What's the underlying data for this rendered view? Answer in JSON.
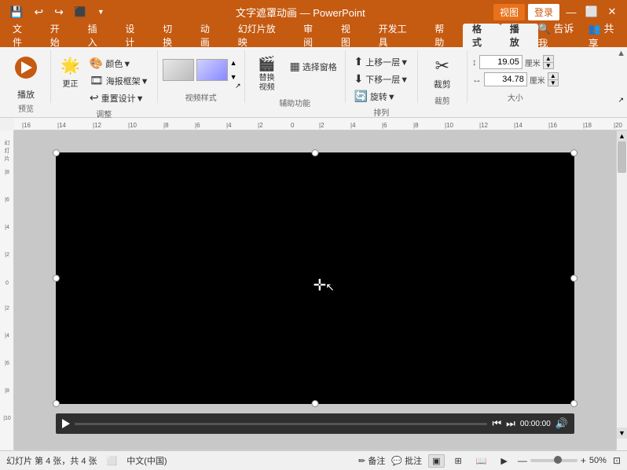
{
  "titlebar": {
    "title": "文字遮罩动画 — PowerPoint",
    "view_tab": "视图",
    "login_btn": "登录"
  },
  "tabs": {
    "items": [
      "文件",
      "开始",
      "插入",
      "设计",
      "切换",
      "动画",
      "幻灯片放映",
      "审阅",
      "视图",
      "开发工具",
      "帮助",
      "格式",
      "播放"
    ]
  },
  "ribbon": {
    "groups": {
      "preview": {
        "label": "预览",
        "play_btn": "播放"
      },
      "adjust": {
        "label": "调整",
        "color": "颜色▼",
        "poster": "海报框架▼",
        "reset": "重置设计▼",
        "more_btn": "更正"
      },
      "video_style": {
        "label": "视频样式",
        "expand_arrow": "↗"
      },
      "accessibility": {
        "label": "辅助功能",
        "replace": "替换\n视频",
        "select_pane": "选择窗格"
      },
      "arrange": {
        "label": "排列",
        "up_layer": "上移一层▼",
        "down_layer": "下移一层▼",
        "rotate": "↻"
      },
      "crop": {
        "label": "裁剪",
        "btn": "裁剪"
      },
      "size": {
        "label": "大小",
        "height_label": "高度",
        "width_label": "宽度",
        "height_value": "19.05 厘米",
        "width_value": "34.78 厘米",
        "height_raw": "19.05",
        "width_raw": "34.78",
        "unit": "厘米"
      }
    }
  },
  "statusbar": {
    "slide_info": "幻灯片 第 4 张，共 4 张",
    "lang": "中文(中国)",
    "notes": "备注",
    "comments": "批注",
    "zoom": "50%"
  },
  "video_controls": {
    "time": "00:00:00"
  }
}
